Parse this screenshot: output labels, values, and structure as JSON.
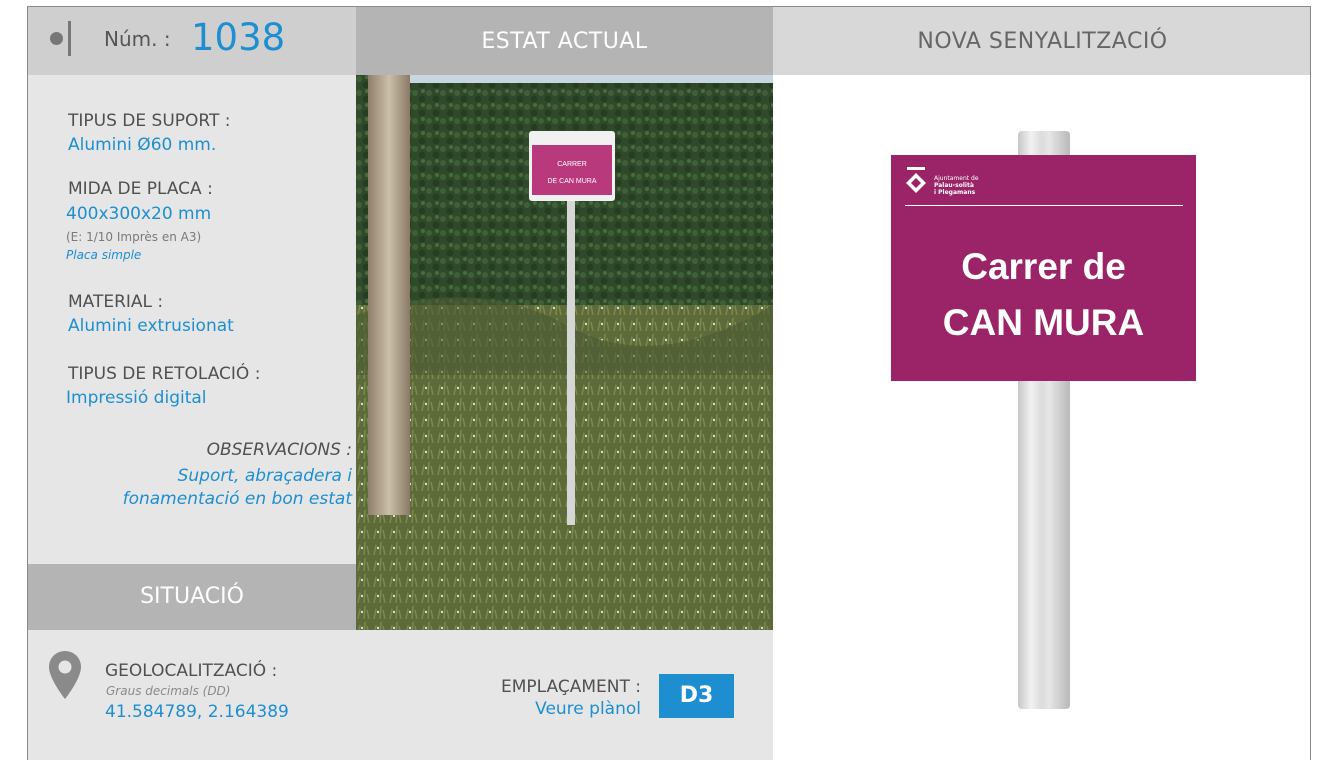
{
  "header": {
    "num_label": "Núm. :",
    "num_value": "1038",
    "estat_title": "ESTAT ACTUAL",
    "nova_title": "NOVA SENYALITZACIÓ"
  },
  "specs": {
    "tipus_suport_label": "TIPUS DE SUPORT :",
    "tipus_suport_value": "Alumini Ø60 mm.",
    "mida_placa_label": "MIDA DE PLACA :",
    "mida_placa_value": "400x300x20 mm",
    "mida_placa_scale": "(E: 1/10 Imprès en A3)",
    "mida_placa_type": "Placa simple",
    "material_label": "MATERIAL :",
    "material_value": "Alumini extrusionat",
    "retolacio_label": "TIPUS DE RETOLACIÓ :",
    "retolacio_value": "Impressió digital",
    "observacions_label": "OBSERVACIONS :",
    "observacions_line1": "Suport, abraçadera i",
    "observacions_line2": "fonamentació en bon estat"
  },
  "situacio": {
    "title": "SITUACIÓ",
    "geo_label": "GEOLOCALITZACIÓ :",
    "geo_format": "Graus decimals (DD)",
    "geo_value": "41.584789, 2.164389",
    "empl_label": "EMPLAÇAMENT :",
    "empl_value": "Veure plànol",
    "empl_code": "D3"
  },
  "photo": {
    "sign_line1": "CARRER",
    "sign_line2": "DE CAN MURA"
  },
  "new_sign": {
    "org_line1": "Ajuntament de",
    "org_line2": "Palau-solità",
    "org_line3": "i Plegamans",
    "title_line1": "Carrer de",
    "title_line2": "CAN MURA",
    "color": "#9b2367"
  },
  "colors": {
    "accent": "#1d8fd1",
    "header_gray": "#b4b4b4",
    "panel_gray": "#e6e6e6"
  }
}
